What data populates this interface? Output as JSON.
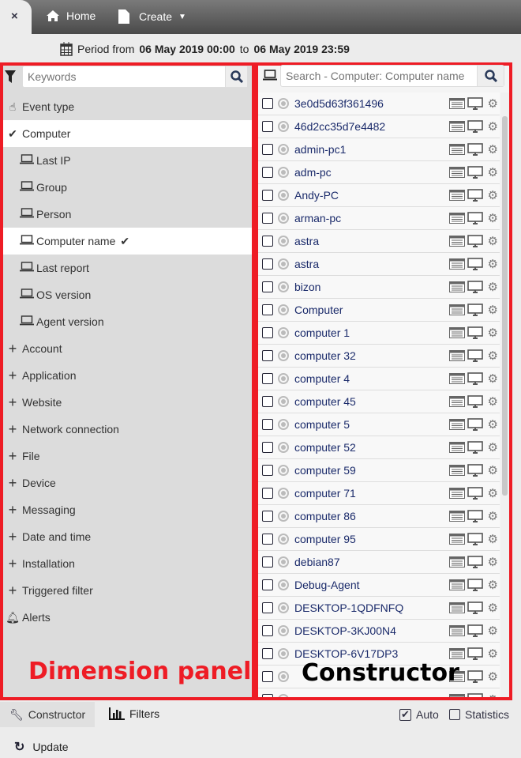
{
  "topbar": {
    "close": "×",
    "home": "Home",
    "create": "Create"
  },
  "period": {
    "prefix": "Period from",
    "from": "06 May 2019 00:00",
    "to_word": "to",
    "to": "06 May 2019 23:59"
  },
  "dimension_panel": {
    "search_placeholder": "Keywords",
    "items": [
      {
        "label": "Event type",
        "icon": "hand-pointer-icon",
        "level": 0,
        "selected": false
      },
      {
        "label": "Computer",
        "icon": "check-icon",
        "level": 0,
        "selected": true
      },
      {
        "label": "Last IP",
        "icon": "laptop-icon",
        "level": 1,
        "selected": false
      },
      {
        "label": "Group",
        "icon": "laptop-icon",
        "level": 1,
        "selected": false
      },
      {
        "label": "Person",
        "icon": "laptop-icon",
        "level": 1,
        "selected": false
      },
      {
        "label": "Computer name",
        "icon": "laptop-icon",
        "level": 1,
        "selected": true,
        "checked": true
      },
      {
        "label": "Last report",
        "icon": "laptop-icon",
        "level": 1,
        "selected": false
      },
      {
        "label": "OS version",
        "icon": "laptop-icon",
        "level": 1,
        "selected": false
      },
      {
        "label": "Agent version",
        "icon": "laptop-icon",
        "level": 1,
        "selected": false
      },
      {
        "label": "Account",
        "icon": "plus-icon",
        "level": 0
      },
      {
        "label": "Application",
        "icon": "plus-icon",
        "level": 0
      },
      {
        "label": "Website",
        "icon": "plus-icon",
        "level": 0
      },
      {
        "label": "Network connection",
        "icon": "plus-icon",
        "level": 0
      },
      {
        "label": "File",
        "icon": "plus-icon",
        "level": 0
      },
      {
        "label": "Device",
        "icon": "plus-icon",
        "level": 0
      },
      {
        "label": "Messaging",
        "icon": "plus-icon",
        "level": 0
      },
      {
        "label": "Date and time",
        "icon": "plus-icon",
        "level": 0
      },
      {
        "label": "Installation",
        "icon": "plus-icon",
        "level": 0
      },
      {
        "label": "Triggered filter",
        "icon": "plus-icon",
        "level": 0
      },
      {
        "label": "Alerts",
        "icon": "bell-icon",
        "level": 0
      }
    ]
  },
  "constructor": {
    "search_placeholder": "Search - Computer: Computer name",
    "rows": [
      "3e0d5d63f361496",
      "46d2cc35d7e4482",
      "admin-pc1",
      "adm-pc",
      "Andy-PC",
      "arman-pc",
      "astra",
      "astra",
      "bizon",
      "Computer",
      "computer 1",
      "computer 32",
      "computer 4",
      "computer 45",
      "computer 5",
      "computer 52",
      "computer 59",
      "computer 71",
      "computer 86",
      "computer 95",
      "debian87",
      "Debug-Agent",
      "DESKTOP-1QDFNFQ",
      "DESKTOP-3KJ00N4",
      "DESKTOP-6V17DP3"
    ]
  },
  "overlays": {
    "dimension": "Dimension panel",
    "constructor": "Constructor"
  },
  "bottom": {
    "constructor_tab": "Constructor",
    "filters_tab": "Filters",
    "auto": "Auto",
    "auto_checked": true,
    "statistics": "Statistics",
    "statistics_checked": false,
    "update": "Update"
  },
  "colors": {
    "highlight": "#ee1c25",
    "link": "#1a2a6a"
  }
}
